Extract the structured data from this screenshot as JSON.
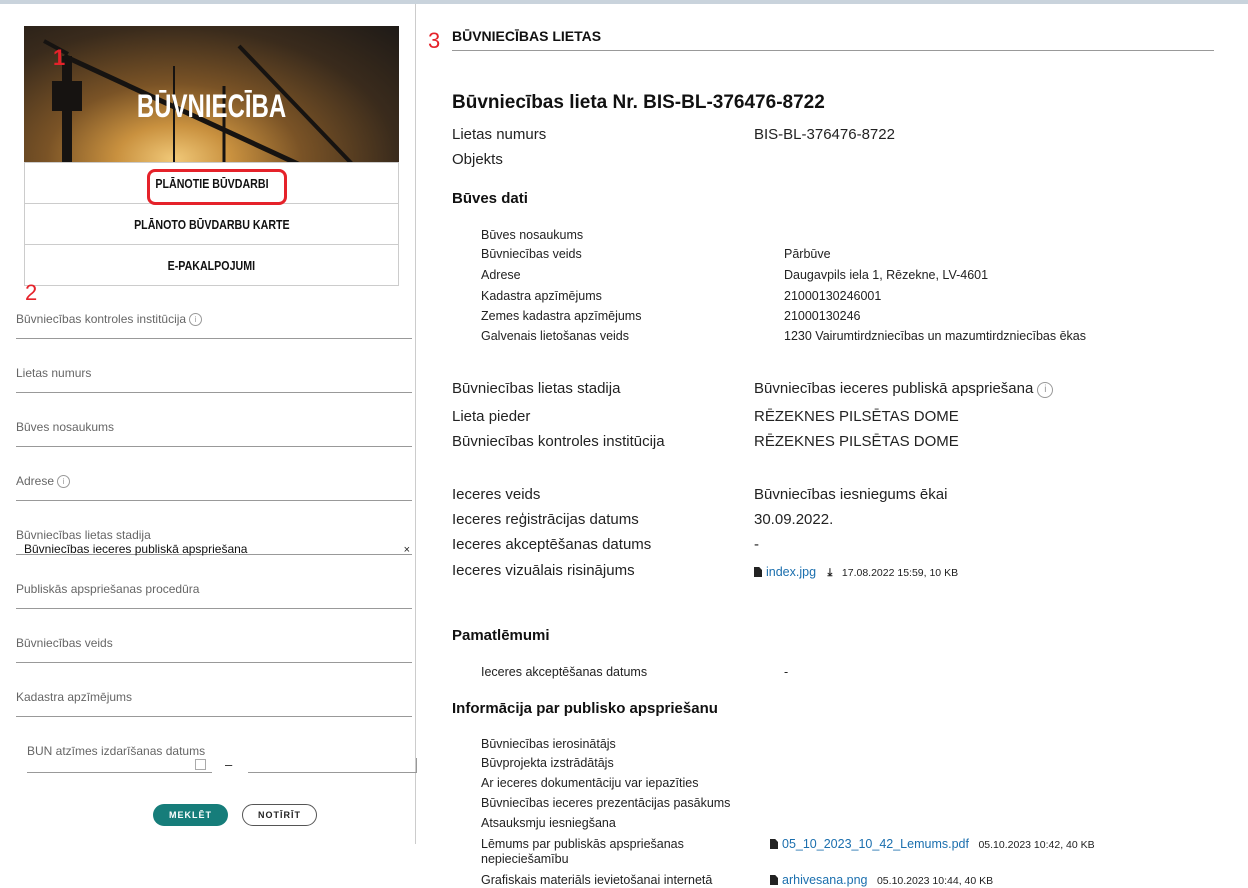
{
  "markers": {
    "one": "1",
    "two": "2",
    "three": "3"
  },
  "sidebar": {
    "hero_title": "BŪVNIECĪBA",
    "nav": [
      "PLĀNOTIE BŪVDARBI",
      "PLĀNOTO BŪVDARBU KARTE",
      "E-PAKALPOJUMI"
    ],
    "filters": [
      {
        "label": "Būvniecības kontroles institūcija",
        "info": true,
        "value": ""
      },
      {
        "label": "Lietas numurs",
        "value": ""
      },
      {
        "label": "Būves nosaukums",
        "value": ""
      },
      {
        "label": "Adrese",
        "info": true,
        "value": ""
      },
      {
        "label": "Būvniecības lietas stadija",
        "value": "Būvniecības ieceres publiskā apspriešana",
        "clear": "×"
      },
      {
        "label": "Publiskās apspriešanas procedūra",
        "value": ""
      },
      {
        "label": "Būvniecības veids",
        "value": ""
      },
      {
        "label": "Kadastra apzīmējums",
        "value": ""
      }
    ],
    "date_label": "BUN atzīmes izdarīšanas datums",
    "date_sep": "–",
    "search_btn": "MEKLĒT",
    "clear_btn": "NOTĪRĪT"
  },
  "main": {
    "section_title": "BŪVNIECĪBAS LIETAS",
    "case_title": "Būvniecības lieta Nr. BIS-BL-376476-8722",
    "top_rows": [
      {
        "label": "Lietas numurs",
        "value": "BIS-BL-376476-8722"
      },
      {
        "label": "Objekts",
        "value": ""
      }
    ],
    "buves_dati_title": "Būves dati",
    "buves_dati": [
      {
        "label": "Būves nosaukums",
        "value": ""
      },
      {
        "label": "Būvniecības veids",
        "value": "Pārbūve"
      },
      {
        "label": "Adrese",
        "value": "Daugavpils iela 1, Rēzekne, LV-4601"
      },
      {
        "label": "Kadastra apzīmējums",
        "value": "21000130246001"
      },
      {
        "label": "Zemes kadastra apzīmējums",
        "value": "21000130246"
      },
      {
        "label": "Galvenais lietošanas veids",
        "value": "1230 Vairumtirdzniecības un mazumtirdzniecības ēkas"
      }
    ],
    "status_rows": [
      {
        "label": "Būvniecības lietas stadija",
        "value": "Būvniecības ieceres publiskā apspriešana"
      },
      {
        "label": "Lieta pieder",
        "value": "RĒZEKNES PILSĒTAS DOME"
      },
      {
        "label": "Būvniecības kontroles institūcija",
        "value": "RĒZEKNES PILSĒTAS DOME"
      }
    ],
    "iecere_rows": [
      {
        "label": "Ieceres veids",
        "value": "Būvniecības iesniegums ēkai"
      },
      {
        "label": "Ieceres reģistrācijas datums",
        "value": "30.09.2022."
      },
      {
        "label": "Ieceres akceptēšanas datums",
        "value": "-"
      },
      {
        "label": "Ieceres vizuālais risinājums",
        "file": "index.jpg",
        "meta": "17.08.2022 15:59, 10 KB"
      }
    ],
    "pamatlemumi_title": "Pamatlēmumi",
    "pamatlemumi": [
      {
        "label": "Ieceres akceptēšanas datums",
        "value": "-"
      }
    ],
    "apspriesana_title": "Informācija par publisko apspriešanu",
    "apspriesana": [
      {
        "label": "Būvniecības ierosinātājs"
      },
      {
        "label": "Būvprojekta izstrādātājs"
      },
      {
        "label": "Ar ieceres dokumentāciju var iepazīties"
      },
      {
        "label": "Būvniecības ieceres prezentācijas pasākums"
      },
      {
        "label": "Atsauksmju iesniegšana"
      },
      {
        "label": "Lēmums par publiskās apspriešanas",
        "label2": "nepieciešamību",
        "file": "05_10_2023_10_42_Lemums.pdf",
        "meta": "05.10.2023 10:42, 40 KB"
      },
      {
        "label": "Grafiskais materiāls ievietošanai internetā",
        "file": "arhivesana.png",
        "meta": "05.10.2023 10:44, 40 KB"
      }
    ]
  }
}
